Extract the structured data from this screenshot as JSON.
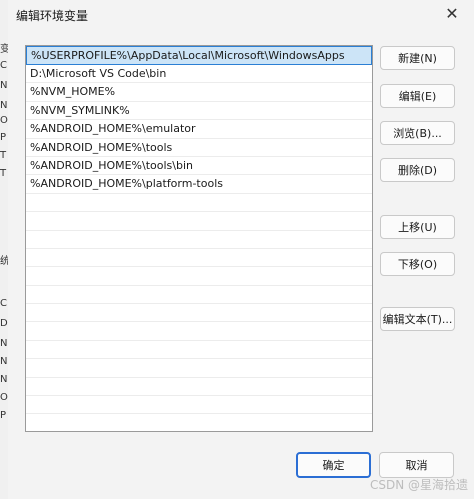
{
  "left_strip": {
    "fragments": [
      "变",
      "C",
      "N",
      "N",
      "O",
      "P",
      "T",
      "T",
      "统",
      "C",
      "D",
      "N",
      "N",
      "N",
      "O",
      "P"
    ]
  },
  "dialog": {
    "title": "编辑环境变量",
    "close_icon": "close-icon"
  },
  "paths": [
    "%USERPROFILE%\\AppData\\Local\\Microsoft\\WindowsApps",
    "D:\\Microsoft VS Code\\bin",
    "%NVM_HOME%",
    "%NVM_SYMLINK%",
    "%ANDROID_HOME%\\emulator",
    "%ANDROID_HOME%\\tools",
    "%ANDROID_HOME%\\tools\\bin",
    "%ANDROID_HOME%\\platform-tools"
  ],
  "selected_index": 0,
  "buttons": {
    "new": "新建(N)",
    "edit": "编辑(E)",
    "browse": "浏览(B)...",
    "delete": "删除(D)",
    "move_up": "上移(U)",
    "move_down": "下移(O)",
    "edit_text": "编辑文本(T)..."
  },
  "footer": {
    "ok": "确定",
    "cancel": "取消"
  },
  "watermark": "CSDN @星海拾遗"
}
